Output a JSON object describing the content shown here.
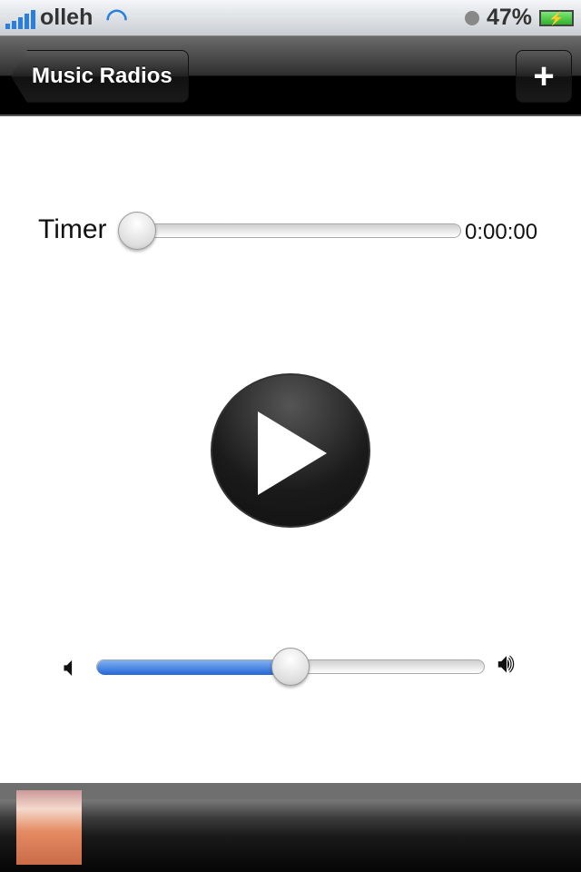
{
  "status_bar": {
    "carrier": "olleh",
    "battery_percent": "47%",
    "signal_icon": "signal-bars-icon",
    "wifi_icon": "wifi-icon",
    "charging": true,
    "accent": "#2b7fdc"
  },
  "nav": {
    "back_label": "Music Radios",
    "add_label": "+"
  },
  "timer": {
    "label": "Timer",
    "value": "0:00:00",
    "slider_fraction": 0
  },
  "player": {
    "play_icon": "play-icon"
  },
  "volume": {
    "level_fraction": 0.5,
    "fill_color": "#2466d6",
    "min_icon": "speaker-low-icon",
    "max_icon": "speaker-high-icon"
  }
}
